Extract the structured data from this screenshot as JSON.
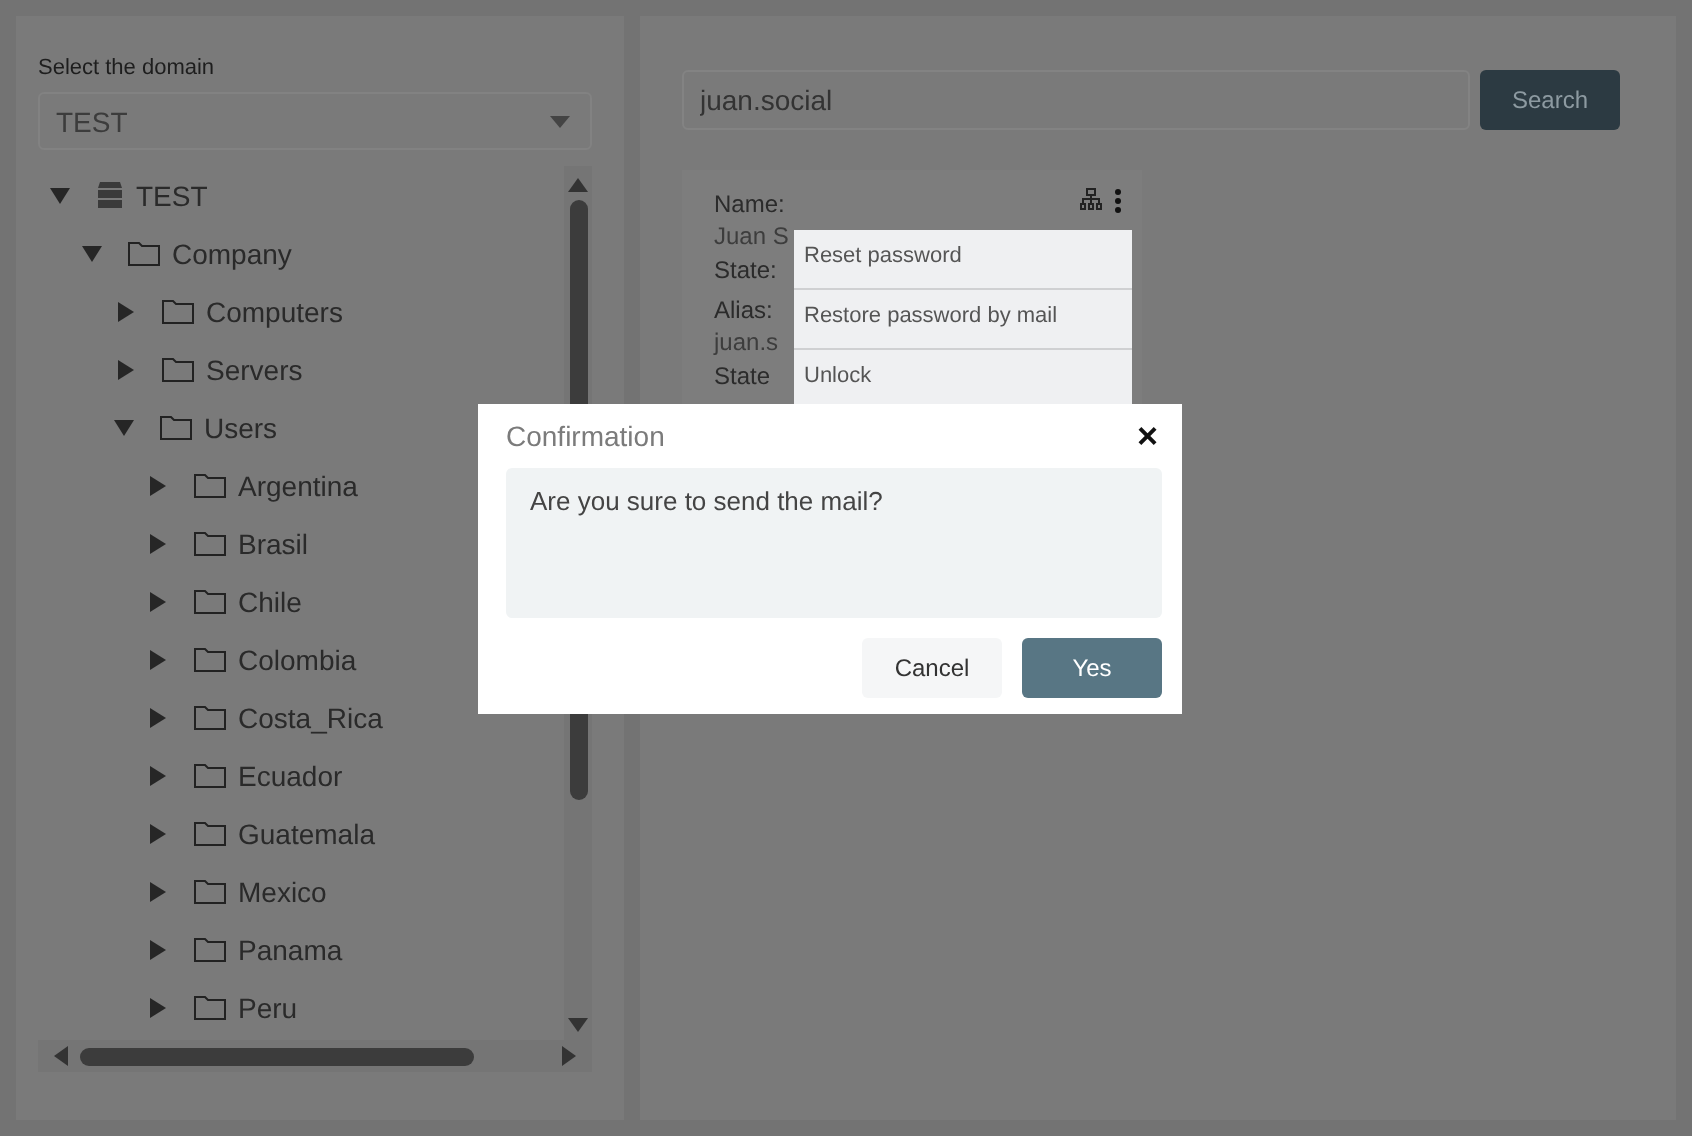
{
  "domain_panel": {
    "label": "Select the domain",
    "select": {
      "value": "TEST"
    },
    "tree": [
      {
        "label": "TEST",
        "kind": "server",
        "expanded": true,
        "children": [
          {
            "label": "Company",
            "kind": "folder",
            "expanded": true,
            "children": [
              {
                "label": "Computers",
                "kind": "folder",
                "expanded": false
              },
              {
                "label": "Servers",
                "kind": "folder",
                "expanded": false
              },
              {
                "label": "Users",
                "kind": "folder",
                "expanded": true,
                "children": [
                  {
                    "label": "Argentina",
                    "kind": "folder",
                    "expanded": false
                  },
                  {
                    "label": "Brasil",
                    "kind": "folder",
                    "expanded": false
                  },
                  {
                    "label": "Chile",
                    "kind": "folder",
                    "expanded": false
                  },
                  {
                    "label": "Colombia",
                    "kind": "folder",
                    "expanded": false
                  },
                  {
                    "label": "Costa_Rica",
                    "kind": "folder",
                    "expanded": false
                  },
                  {
                    "label": "Ecuador",
                    "kind": "folder",
                    "expanded": false
                  },
                  {
                    "label": "Guatemala",
                    "kind": "folder",
                    "expanded": false
                  },
                  {
                    "label": "Mexico",
                    "kind": "folder",
                    "expanded": false
                  },
                  {
                    "label": "Panama",
                    "kind": "folder",
                    "expanded": false
                  },
                  {
                    "label": "Peru",
                    "kind": "folder",
                    "expanded": false
                  }
                ]
              }
            ]
          }
        ]
      }
    ]
  },
  "search": {
    "value": "juan.social",
    "button": "Search"
  },
  "user_card": {
    "fields": [
      {
        "label": "Name:",
        "value": "Juan S"
      },
      {
        "label": "State:"
      },
      {
        "label": "Alias:",
        "value": "juan.s"
      },
      {
        "label": "State"
      }
    ]
  },
  "action_menu": [
    "Reset password",
    "Restore password by mail",
    "Unlock"
  ],
  "dialog": {
    "title": "Confirmation",
    "close": "×",
    "message": "Are you sure to send the mail?",
    "buttons": [
      {
        "label": "Cancel",
        "kind": "secondary"
      },
      {
        "label": "Yes",
        "kind": "primary"
      }
    ]
  }
}
